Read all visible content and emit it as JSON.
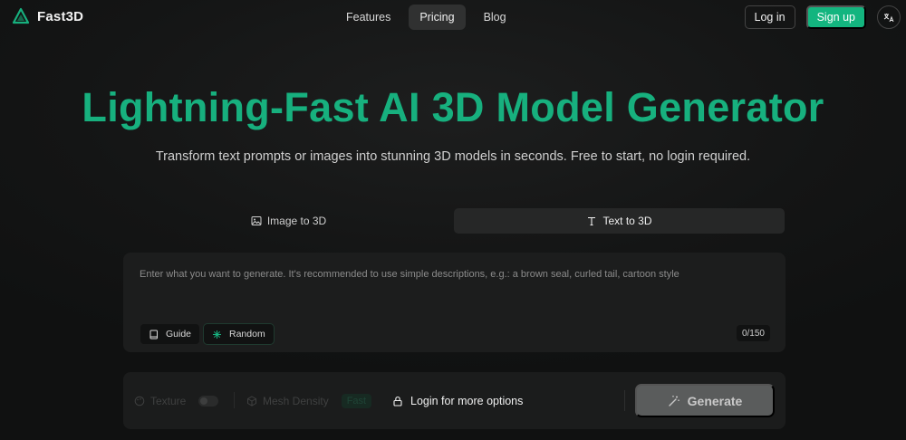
{
  "brand": {
    "name": "Fast3D",
    "accent": "#13b57f"
  },
  "nav": {
    "items": [
      "Features",
      "Pricing",
      "Blog"
    ],
    "active": "Pricing"
  },
  "auth": {
    "login": "Log in",
    "signup": "Sign up"
  },
  "hero": {
    "title": "Lightning-Fast AI 3D Model Generator",
    "subtitle": "Transform text prompts or images into stunning 3D models in seconds. Free to start, no login required."
  },
  "tabs": [
    {
      "label": "Image to 3D",
      "icon": "image-icon",
      "active": false
    },
    {
      "label": "Text to 3D",
      "icon": "text-icon",
      "active": true
    }
  ],
  "prompt": {
    "placeholder": "Enter what you want to generate. It's recommended to use simple descriptions, e.g.: a brown seal, curled tail, cartoon style",
    "value": "",
    "guide_label": "Guide",
    "random_label": "Random",
    "counter": "0/150"
  },
  "options": {
    "texture_label": "Texture",
    "mesh_label": "Mesh Density",
    "mesh_value": "Fast",
    "login_more": "Login for more options",
    "generate_label": "Generate"
  },
  "icons": [
    "logo-icon",
    "language-icon",
    "image-icon",
    "text-icon",
    "book-icon",
    "sparkle-icon",
    "palette-icon",
    "cube-icon",
    "lock-icon",
    "magic-wand-icon"
  ]
}
